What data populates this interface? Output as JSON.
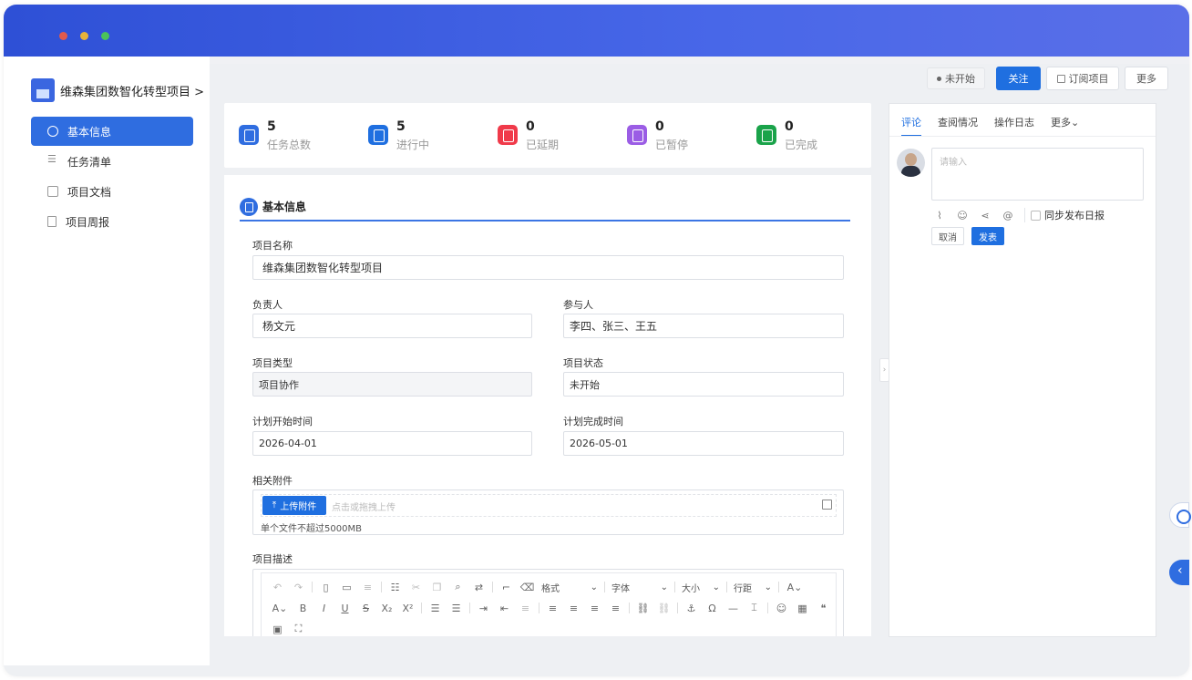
{
  "colors": {
    "accent": "#1f6fe0",
    "titlebar": "#3d5ce0"
  },
  "sidebar": {
    "project_title": "维森集团数智化转型项目 >",
    "items": [
      {
        "label": "基本信息",
        "icon": "clock-icon",
        "active": true
      },
      {
        "label": "任务清单",
        "icon": "list-icon",
        "active": false
      },
      {
        "label": "项目文档",
        "icon": "document-icon",
        "active": false
      },
      {
        "label": "项目周报",
        "icon": "report-icon",
        "active": false
      }
    ]
  },
  "topbar": {
    "status": "未开始",
    "follow_label": "关注",
    "subscribe_label": "订阅项目",
    "more_label": "更多"
  },
  "stats": [
    {
      "value": "5",
      "label": "任务总数",
      "color": "#2f6de0"
    },
    {
      "value": "5",
      "label": "进行中",
      "color": "#1f6fe0"
    },
    {
      "value": "0",
      "label": "已延期",
      "color": "#f03a4a"
    },
    {
      "value": "0",
      "label": "已暂停",
      "color": "#9b5de5"
    },
    {
      "value": "0",
      "label": "已完成",
      "color": "#1aa34a"
    }
  ],
  "form": {
    "section_title": "基本信息",
    "project_name_label": "项目名称",
    "project_name": "维森集团数智化转型项目",
    "owner_label": "负责人",
    "owner": "杨文元",
    "participants_label": "参与人",
    "participants": "李四、张三、王五",
    "type_label": "项目类型",
    "type": "项目协作",
    "status_label": "项目状态",
    "status": "未开始",
    "start_label": "计划开始时间",
    "start": "2026-04-01",
    "end_label": "计划完成时间",
    "end": "2026-05-01",
    "attachment_label": "相关附件",
    "upload_label": "上传附件",
    "upload_hint": "点击或拖拽上传",
    "upload_limit": "单个文件不超过5000MB",
    "description_label": "项目描述"
  },
  "editor": {
    "format_label": "格式",
    "font_label": "字体",
    "size_label": "大小",
    "line_height_label": "行距"
  },
  "comments": {
    "tabs": [
      "评论",
      "查阅情况",
      "操作日志",
      "更多"
    ],
    "placeholder": "请输入",
    "sync_label": "同步发布日报",
    "cancel_label": "取消",
    "post_label": "发表"
  }
}
